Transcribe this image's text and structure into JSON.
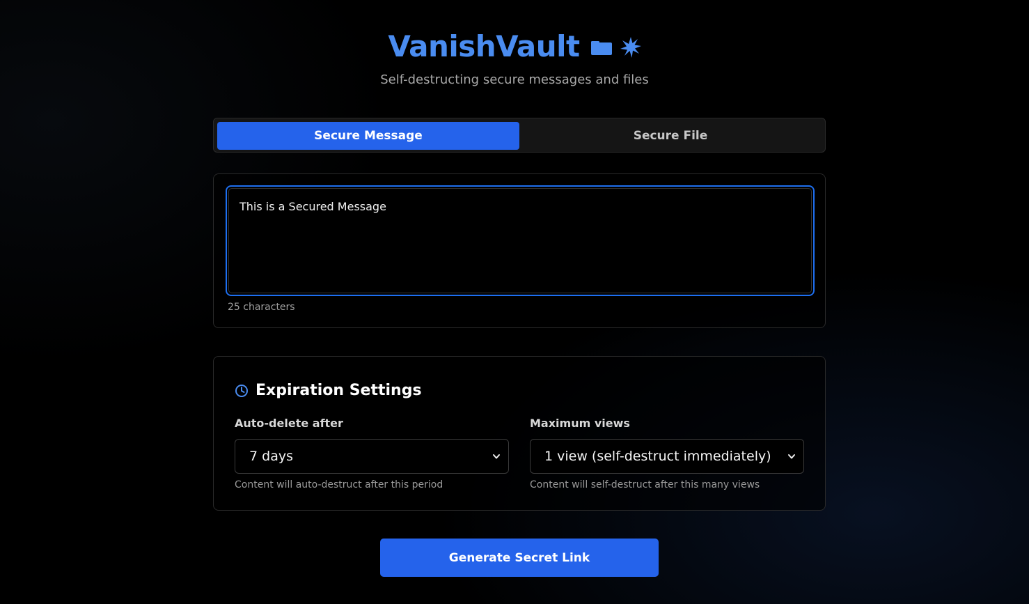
{
  "app": {
    "title": "VanishVault",
    "subtitle": "Self-destructing secure messages and files"
  },
  "tabs": [
    {
      "label": "Secure Message",
      "active": true
    },
    {
      "label": "Secure File",
      "active": false
    }
  ],
  "message": {
    "value": "This is a Secured Message",
    "char_count": "25 characters"
  },
  "expiration": {
    "title": "Expiration Settings",
    "auto_delete": {
      "label": "Auto-delete after",
      "value": "7 days",
      "help": "Content will auto-destruct after this period"
    },
    "max_views": {
      "label": "Maximum views",
      "value": "1 view (self-destruct immediately)",
      "help": "Content will self-destruct after this many views"
    }
  },
  "actions": {
    "generate_label": "Generate Secret Link"
  },
  "colors": {
    "accent": "#2563eb",
    "title": "#4a8cf0",
    "focus_ring": "#1e6ff0"
  }
}
